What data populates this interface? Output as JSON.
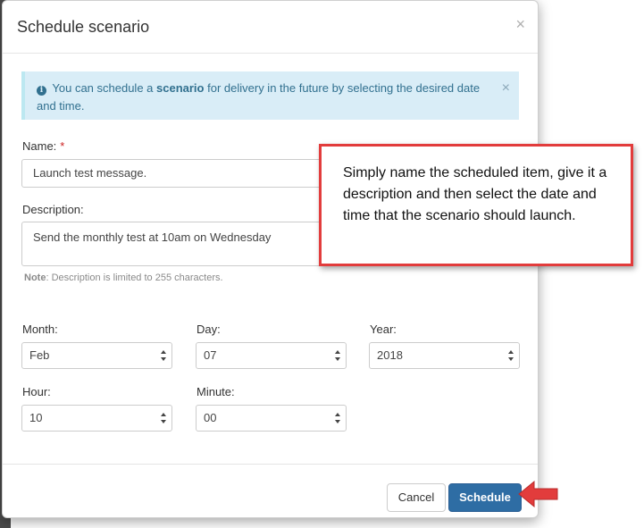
{
  "modal": {
    "title": "Schedule scenario",
    "close_glyph": "×"
  },
  "alert": {
    "icon": "info-circle-icon",
    "text_before": "You can schedule a ",
    "text_bold": "scenario",
    "text_after": " for delivery in the future by selecting the desired date and time.",
    "close_glyph": "×"
  },
  "form": {
    "name_label": "Name:",
    "required_mark": "*",
    "name_value": "Launch test message.",
    "description_label": "Description:",
    "description_value": "Send the monthly test at 10am on Wednesday",
    "note_bold": "Note",
    "note_text": ": Description is limited to 255 characters.",
    "month_label": "Month:",
    "month_value": "Feb",
    "day_label": "Day:",
    "day_value": "07",
    "year_label": "Year:",
    "year_value": "2018",
    "hour_label": "Hour:",
    "hour_value": "10",
    "minute_label": "Minute:",
    "minute_value": "00"
  },
  "footer": {
    "cancel_label": "Cancel",
    "schedule_label": "Schedule"
  },
  "callout": {
    "text": "Simply name the scheduled item, give it a description and then select the date and time that the scenario should launch."
  },
  "colors": {
    "primary_button": "#2e6da4",
    "alert_bg": "#d9edf7",
    "alert_text": "#31708f",
    "callout_border": "#e23c3c",
    "required": "#cc2222"
  }
}
